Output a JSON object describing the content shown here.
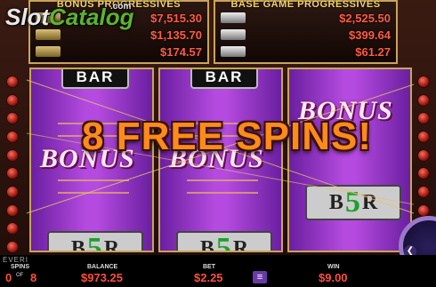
{
  "logo": {
    "text_a": "Slot",
    "text_b": "Catalog",
    "sup": ".com"
  },
  "bonus_progressives": {
    "title": "BONUS PROGRESSIVES",
    "values": [
      "$7,515.30",
      "$1,135.70",
      "$174.57"
    ]
  },
  "base_progressives": {
    "title": "BASE GAME PROGRESSIVES",
    "values": [
      "$2,525.50",
      "$399.64",
      "$61.27"
    ]
  },
  "reels": {
    "bar": "BAR",
    "bonus": "BONUS",
    "b5r_left": "B",
    "b5r_five": "5",
    "b5r_right": "R"
  },
  "banner": "8 FREE SPINS!",
  "bottom": {
    "brand": "EVERI",
    "spins_label": "SPINS",
    "spins_current": "0",
    "spins_of": "OF",
    "spins_total": "8",
    "balance_label": "BALANCE",
    "balance": "$973.25",
    "bet_label": "BET",
    "bet": "$2.25",
    "win_label": "WIN",
    "win": "$9.00",
    "menu": "≡"
  },
  "colors": {
    "accent": "#ff8a1c",
    "value": "#ff4e3a",
    "reel": "#b44adf"
  }
}
